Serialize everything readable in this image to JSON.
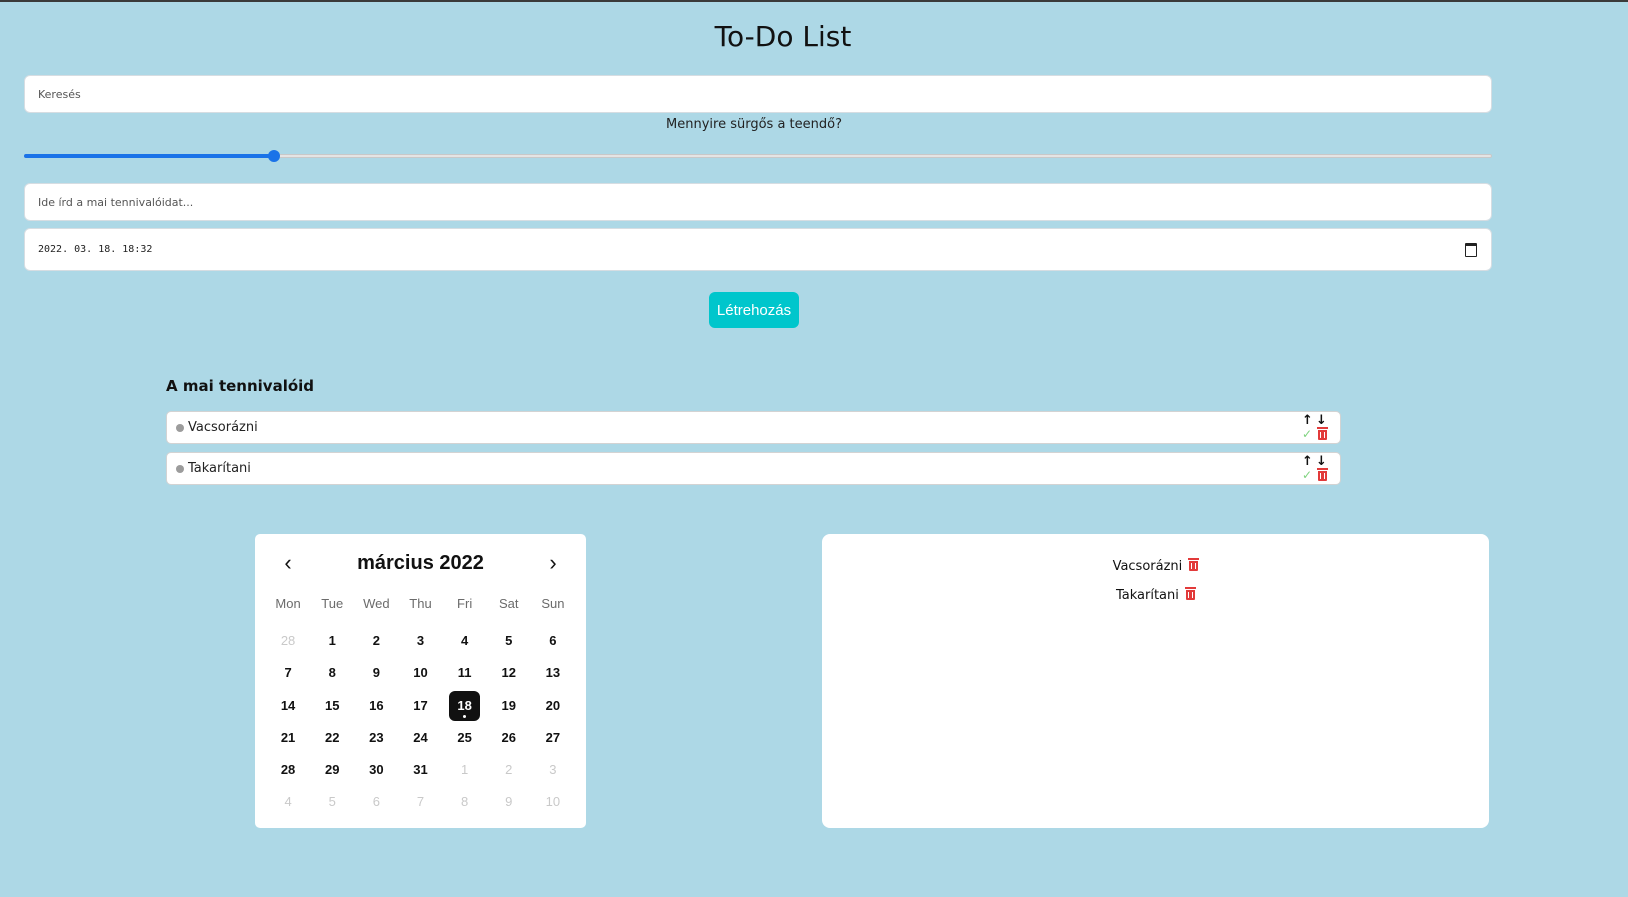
{
  "app": {
    "title": "To-Do List"
  },
  "search": {
    "placeholder": "Keresés"
  },
  "urgency": {
    "label": "Mennyire sürgős a teendő?",
    "value_percent": 17
  },
  "todo_input": {
    "placeholder": "Ide írd a mai tennivalóidat..."
  },
  "datetime": {
    "value": "2022. 03. 18. 18:32"
  },
  "create_button": {
    "label": "Létrehozás"
  },
  "todos": {
    "heading": "A mai tennivalóid",
    "items": [
      {
        "label": "Vacsorázni"
      },
      {
        "label": "Takarítani"
      }
    ]
  },
  "icons": {
    "up": "arrow-up-icon",
    "down": "arrow-down-icon",
    "done": "check-icon",
    "delete": "trash-icon",
    "calendar": "calendar-icon"
  },
  "colors": {
    "background": "#add8e6",
    "accent": "#1a73e8",
    "button": "#00c6cc",
    "delete": "#e23a3a",
    "done": "#7ed37e"
  },
  "calendar": {
    "month_label": "március 2022",
    "prev": "‹",
    "next": "›",
    "weekdays": [
      "Mon",
      "Tue",
      "Wed",
      "Thu",
      "Fri",
      "Sat",
      "Sun"
    ],
    "weeks": [
      [
        {
          "d": "28",
          "m": true
        },
        {
          "d": "1"
        },
        {
          "d": "2"
        },
        {
          "d": "3"
        },
        {
          "d": "4"
        },
        {
          "d": "5"
        },
        {
          "d": "6"
        }
      ],
      [
        {
          "d": "7"
        },
        {
          "d": "8"
        },
        {
          "d": "9"
        },
        {
          "d": "10"
        },
        {
          "d": "11"
        },
        {
          "d": "12"
        },
        {
          "d": "13"
        }
      ],
      [
        {
          "d": "14"
        },
        {
          "d": "15"
        },
        {
          "d": "16"
        },
        {
          "d": "17"
        },
        {
          "d": "18",
          "t": true
        },
        {
          "d": "19"
        },
        {
          "d": "20"
        }
      ],
      [
        {
          "d": "21"
        },
        {
          "d": "22"
        },
        {
          "d": "23"
        },
        {
          "d": "24"
        },
        {
          "d": "25"
        },
        {
          "d": "26"
        },
        {
          "d": "27"
        }
      ],
      [
        {
          "d": "28"
        },
        {
          "d": "29"
        },
        {
          "d": "30"
        },
        {
          "d": "31"
        },
        {
          "d": "1",
          "m": true
        },
        {
          "d": "2",
          "m": true
        },
        {
          "d": "3",
          "m": true
        }
      ],
      [
        {
          "d": "4",
          "m": true
        },
        {
          "d": "5",
          "m": true
        },
        {
          "d": "6",
          "m": true
        },
        {
          "d": "7",
          "m": true
        },
        {
          "d": "8",
          "m": true
        },
        {
          "d": "9",
          "m": true
        },
        {
          "d": "10",
          "m": true
        }
      ]
    ]
  },
  "events": {
    "items": [
      {
        "label": "Vacsorázni"
      },
      {
        "label": "Takarítani"
      }
    ]
  }
}
